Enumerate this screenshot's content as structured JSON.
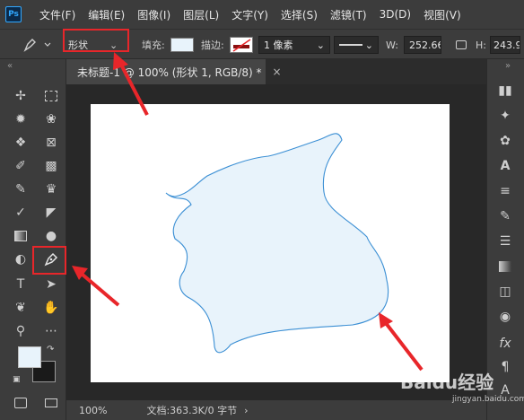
{
  "app": {
    "logo": "Ps"
  },
  "menu": [
    "文件(F)",
    "编辑(E)",
    "图像(I)",
    "图层(L)",
    "文字(Y)",
    "选择(S)",
    "滤镜(T)",
    "3D(D)",
    "视图(V)"
  ],
  "options": {
    "mode": "形状",
    "fill_label": "填充:",
    "stroke_label": "描边:",
    "stroke_width": "1 像素",
    "w_label": "W:",
    "w_value": "252.66",
    "h_label": "H:",
    "h_value": "243.9"
  },
  "document": {
    "tab_title": "未标题-1 @ 100% (形状 1, RGB/8) *",
    "tab_close": "×"
  },
  "status": {
    "zoom": "100%",
    "doc_info": "文档:363.3K/0 字节"
  },
  "colors": {
    "shape_fill": "#e8f3fb",
    "shape_stroke": "#3b8fd4",
    "annotation": "#e8262a"
  },
  "watermark": {
    "brand": "Baidu经验",
    "sub": "jingyan.baidu.com"
  }
}
